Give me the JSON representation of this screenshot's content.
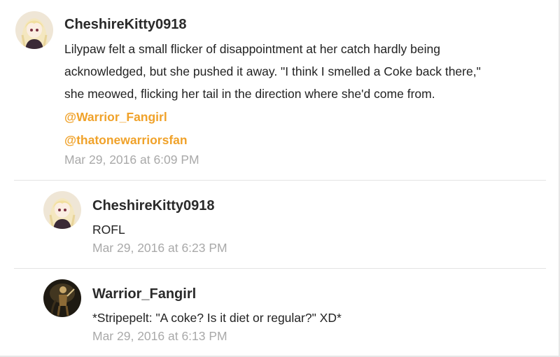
{
  "comments": [
    {
      "author": "CheshireKitty0918",
      "avatar_icon": "anime-girl-avatar-icon",
      "lines": [
        "Lilypaw felt a small flicker of disappointment at her catch hardly being",
        "acknowledged, but she pushed it away. \"I think I smelled a Coke back there,\"",
        "she meowed, flicking her tail in the direction where she'd come from."
      ],
      "mentions": [
        "@Warrior_Fangirl",
        "@thatonewarriorsfan"
      ],
      "timestamp": "Mar 29, 2016 at 6:09 PM"
    },
    {
      "author": "CheshireKitty0918",
      "avatar_icon": "anime-girl-avatar-icon",
      "lines": [
        "ROFL"
      ],
      "timestamp": "Mar 29, 2016 at 6:23 PM"
    },
    {
      "author": "Warrior_Fangirl",
      "avatar_icon": "warrior-figure-avatar-icon",
      "lines": [
        "*Stripepelt: \"A coke? Is it diet or regular?\" XD*"
      ],
      "timestamp": "Mar 29, 2016 at 6:13 PM"
    }
  ],
  "colors": {
    "mention": "#f0a22a",
    "timestamp": "#a9a9a9",
    "author": "#2a2a2a"
  }
}
